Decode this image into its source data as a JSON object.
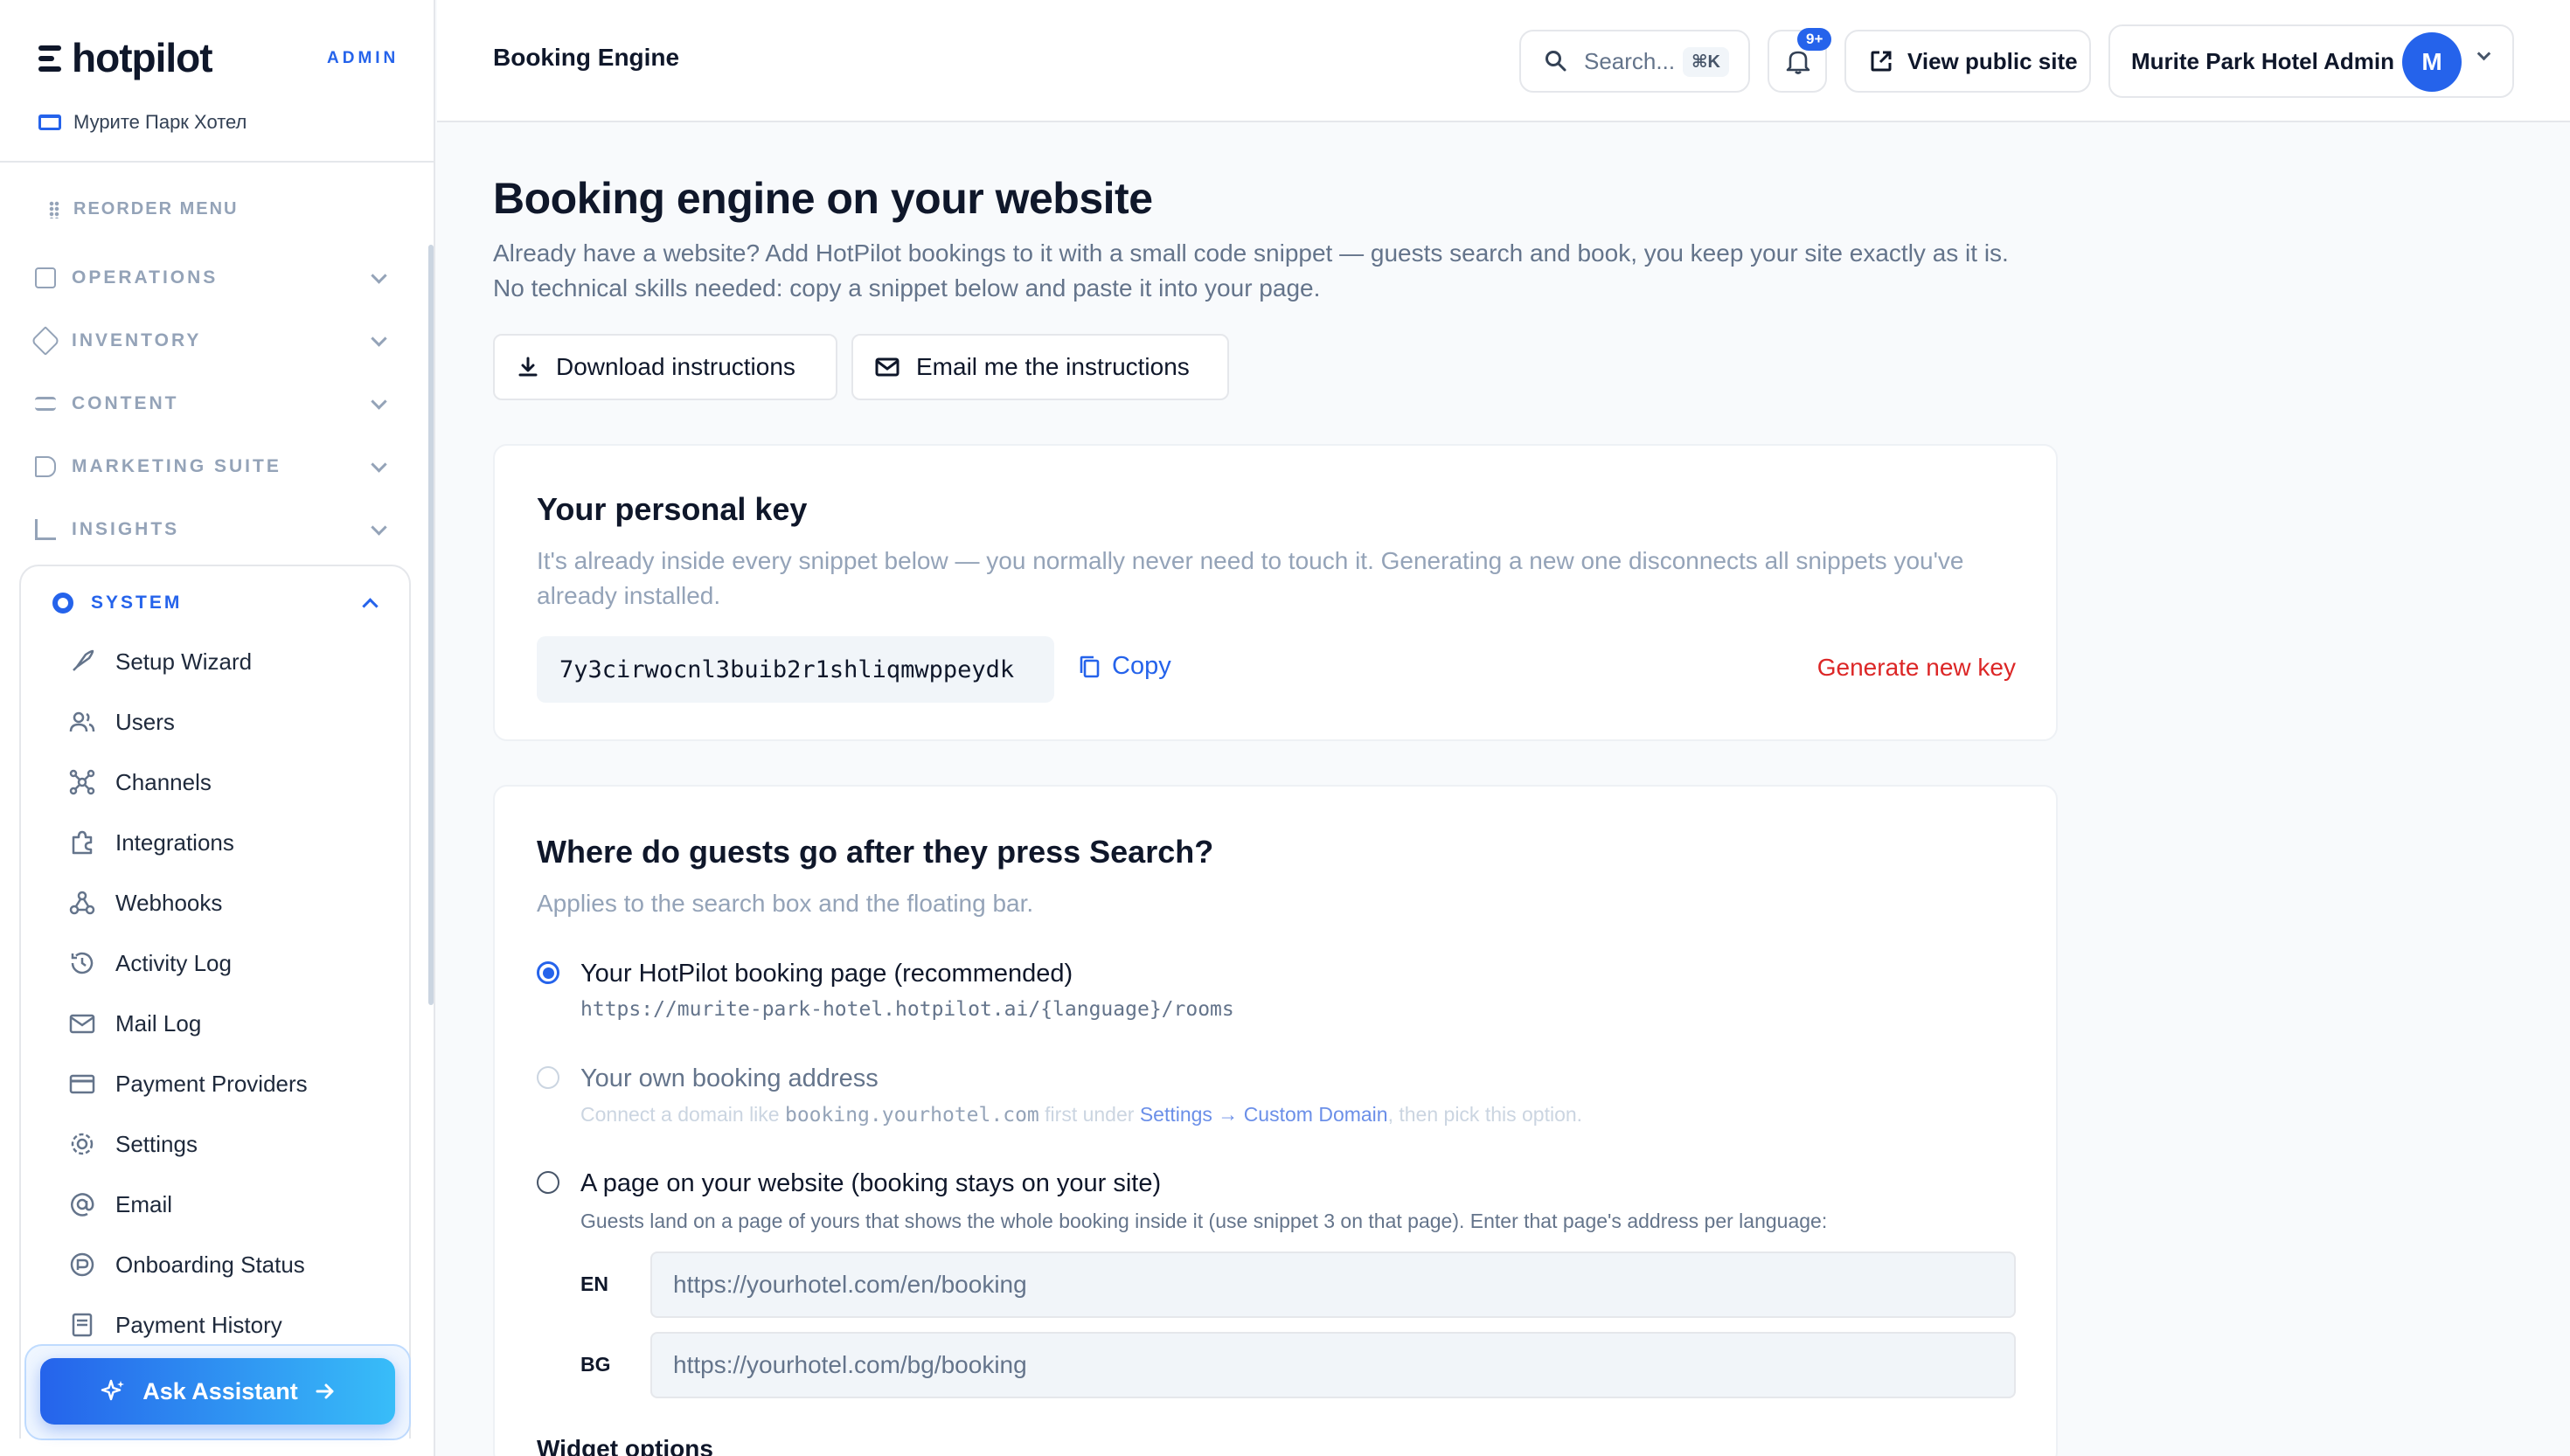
{
  "sidebar": {
    "logo": "hotpilot",
    "role_tag": "ADMIN",
    "hotel_name": "Мурите Парк Хотел",
    "reorder_label": "REORDER MENU",
    "sections": [
      {
        "label": "OPERATIONS",
        "icon": "layout-icon"
      },
      {
        "label": "INVENTORY",
        "icon": "tag-icon"
      },
      {
        "label": "CONTENT",
        "icon": "text-edit-icon"
      },
      {
        "label": "MARKETING SUITE",
        "icon": "megaphone-icon"
      },
      {
        "label": "INSIGHTS",
        "icon": "bar-chart-icon"
      }
    ],
    "system": {
      "label": "SYSTEM",
      "items": [
        {
          "label": "Setup Wizard",
          "icon": "rocket-icon"
        },
        {
          "label": "Users",
          "icon": "users-icon"
        },
        {
          "label": "Channels",
          "icon": "network-icon"
        },
        {
          "label": "Integrations",
          "icon": "puzzle-icon"
        },
        {
          "label": "Webhooks",
          "icon": "webhook-icon"
        },
        {
          "label": "Activity Log",
          "icon": "history-icon"
        },
        {
          "label": "Mail Log",
          "icon": "mail-icon"
        },
        {
          "label": "Payment Providers",
          "icon": "credit-card-icon"
        },
        {
          "label": "Settings",
          "icon": "gear-icon"
        },
        {
          "label": "Email",
          "icon": "at-sign-icon"
        },
        {
          "label": "Onboarding Status",
          "icon": "progress-icon"
        },
        {
          "label": "Payment History",
          "icon": "receipt-icon"
        }
      ]
    },
    "assistant_label": "Ask Assistant"
  },
  "topbar": {
    "title": "Booking Engine",
    "search_placeholder": "Search...",
    "search_shortcut": "⌘K",
    "notifications_badge": "9+",
    "view_site_label": "View public site",
    "user_name": "Murite Park Hotel Admin",
    "user_initial": "M"
  },
  "main": {
    "heading": "Booking engine on your website",
    "lead_line1": "Already have a website? Add HotPilot bookings to it with a small code snippet — guests search and book, you keep your site exactly as it is.",
    "lead_line2": "No technical skills needed: copy a snippet below and paste it into your page.",
    "download_label": "Download instructions",
    "email_label": "Email me the instructions",
    "key_card": {
      "title": "Your personal key",
      "description": "It's already inside every snippet below — you normally never need to touch it. Generating a new one disconnects all snippets you've already installed.",
      "key": "7y3cirwocnl3buib2r1shliqmwppeydk",
      "copy_label": "Copy",
      "generate_label": "Generate new key"
    },
    "destination_card": {
      "title": "Where do guests go after they press Search?",
      "subtitle": "Applies to the search box and the floating bar.",
      "option1_title": "Your HotPilot booking page (recommended)",
      "option1_url": "https://murite-park-hotel.hotpilot.ai/{language}/rooms",
      "option2_title": "Your own booking address",
      "option2_sub_before": "Connect a domain like",
      "option2_sub_domain": "booking.yourhotel.com",
      "option2_sub_middle": "first under",
      "option2_sub_link": "Settings → Custom Domain",
      "option2_sub_after": ", then pick this option.",
      "option3_title": "A page on your website (booking stays on your site)",
      "option3_sub": "Guests land on a page of yours that shows the whole booking inside it (use snippet 3 on that page). Enter that page's address per language:",
      "languages": [
        {
          "code": "EN",
          "placeholder": "https://yourhotel.com/en/booking"
        },
        {
          "code": "BG",
          "placeholder": "https://yourhotel.com/bg/booking"
        }
      ],
      "widget_options_label": "Widget options"
    }
  },
  "colors": {
    "accent": "#2563eb",
    "danger": "#dc2626",
    "muted": "#94a3b8"
  }
}
